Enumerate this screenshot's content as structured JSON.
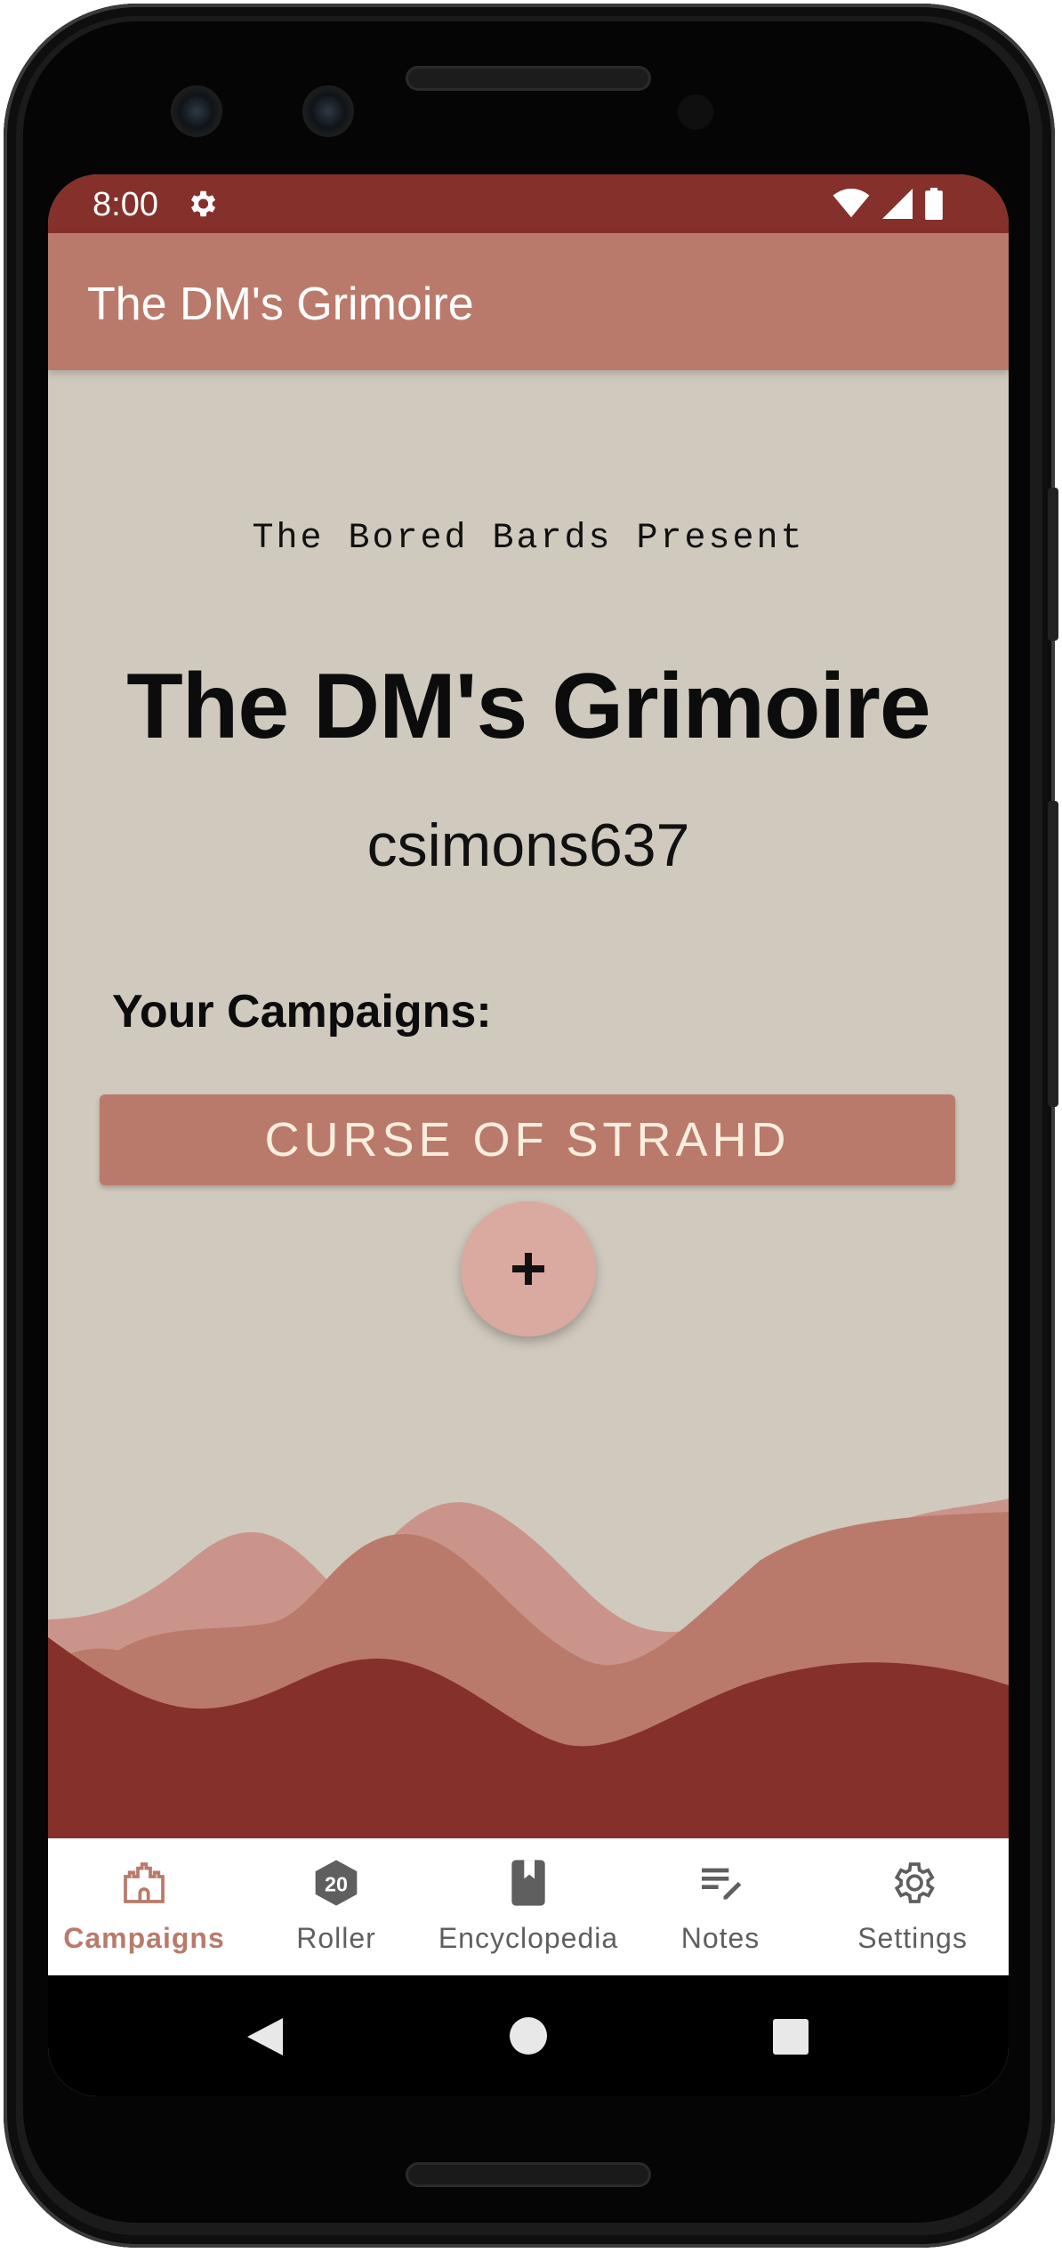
{
  "status_bar": {
    "time": "8:00",
    "icons": [
      "gear-icon",
      "wifi-icon",
      "signal-icon",
      "battery-icon"
    ]
  },
  "app_bar": {
    "title": "The DM's Grimoire"
  },
  "main": {
    "presenter": "The Bored Bards Present",
    "title": "The DM's Grimoire",
    "username": "csimons637",
    "campaigns_label": "Your Campaigns:",
    "campaigns": [
      {
        "name": "CURSE OF STRAHD"
      }
    ],
    "add_button_icon": "plus-icon"
  },
  "bottom_nav": {
    "items": [
      {
        "label": "Campaigns",
        "icon": "castle-icon",
        "active": true
      },
      {
        "label": "Roller",
        "icon": "d20-icon",
        "icon_text": "20",
        "active": false
      },
      {
        "label": "Encyclopedia",
        "icon": "book-icon",
        "active": false
      },
      {
        "label": "Notes",
        "icon": "notes-edit-icon",
        "active": false
      },
      {
        "label": "Settings",
        "icon": "settings-icon",
        "active": false
      }
    ]
  },
  "system_nav": {
    "icons": [
      "back-icon",
      "home-icon",
      "recents-icon"
    ]
  },
  "colors": {
    "status_bar": "#85302b",
    "app_bar": "#ba7a6b",
    "background": "#d0c9be",
    "campaign_button": "#ba7a6b",
    "campaign_button_text": "#fbeede",
    "fab": "#daa9a0",
    "active_nav": "#ba7a6b",
    "inactive_nav": "#5f5f5f",
    "hill_light": "#cb948a",
    "hill_mid": "#ba7a6b",
    "hill_dark": "#85302b"
  }
}
